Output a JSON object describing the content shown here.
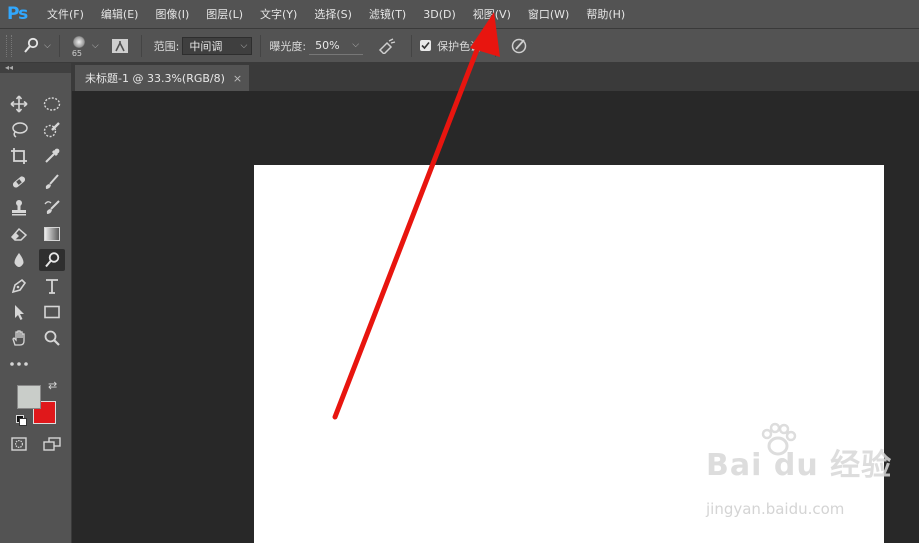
{
  "app": {
    "logo": "Ps"
  },
  "menu": [
    "文件(F)",
    "编辑(E)",
    "图像(I)",
    "图层(L)",
    "文字(Y)",
    "选择(S)",
    "滤镜(T)",
    "3D(D)",
    "视图(V)",
    "窗口(W)",
    "帮助(H)"
  ],
  "options": {
    "brush_size": "65",
    "range_label": "范围:",
    "range_value": "中间调",
    "exposure_label": "曝光度:",
    "exposure_value": "50%",
    "protect_tones_label": "保护色调",
    "protect_tones_checked": true
  },
  "toolbox": {
    "collapse_label": "◂◂",
    "foreground_color": "#c9cdc9",
    "background_color": "#e0181b"
  },
  "document": {
    "tab_title": "未标题-1 @ 33.3%(RGB/8)",
    "close_glyph": "×",
    "canvas_color": "#ffffff"
  },
  "annotation": {
    "arrow_color": "#e8150f"
  },
  "watermark": {
    "brand": "Bai du 经验",
    "url": "jingyan.baidu.com"
  }
}
